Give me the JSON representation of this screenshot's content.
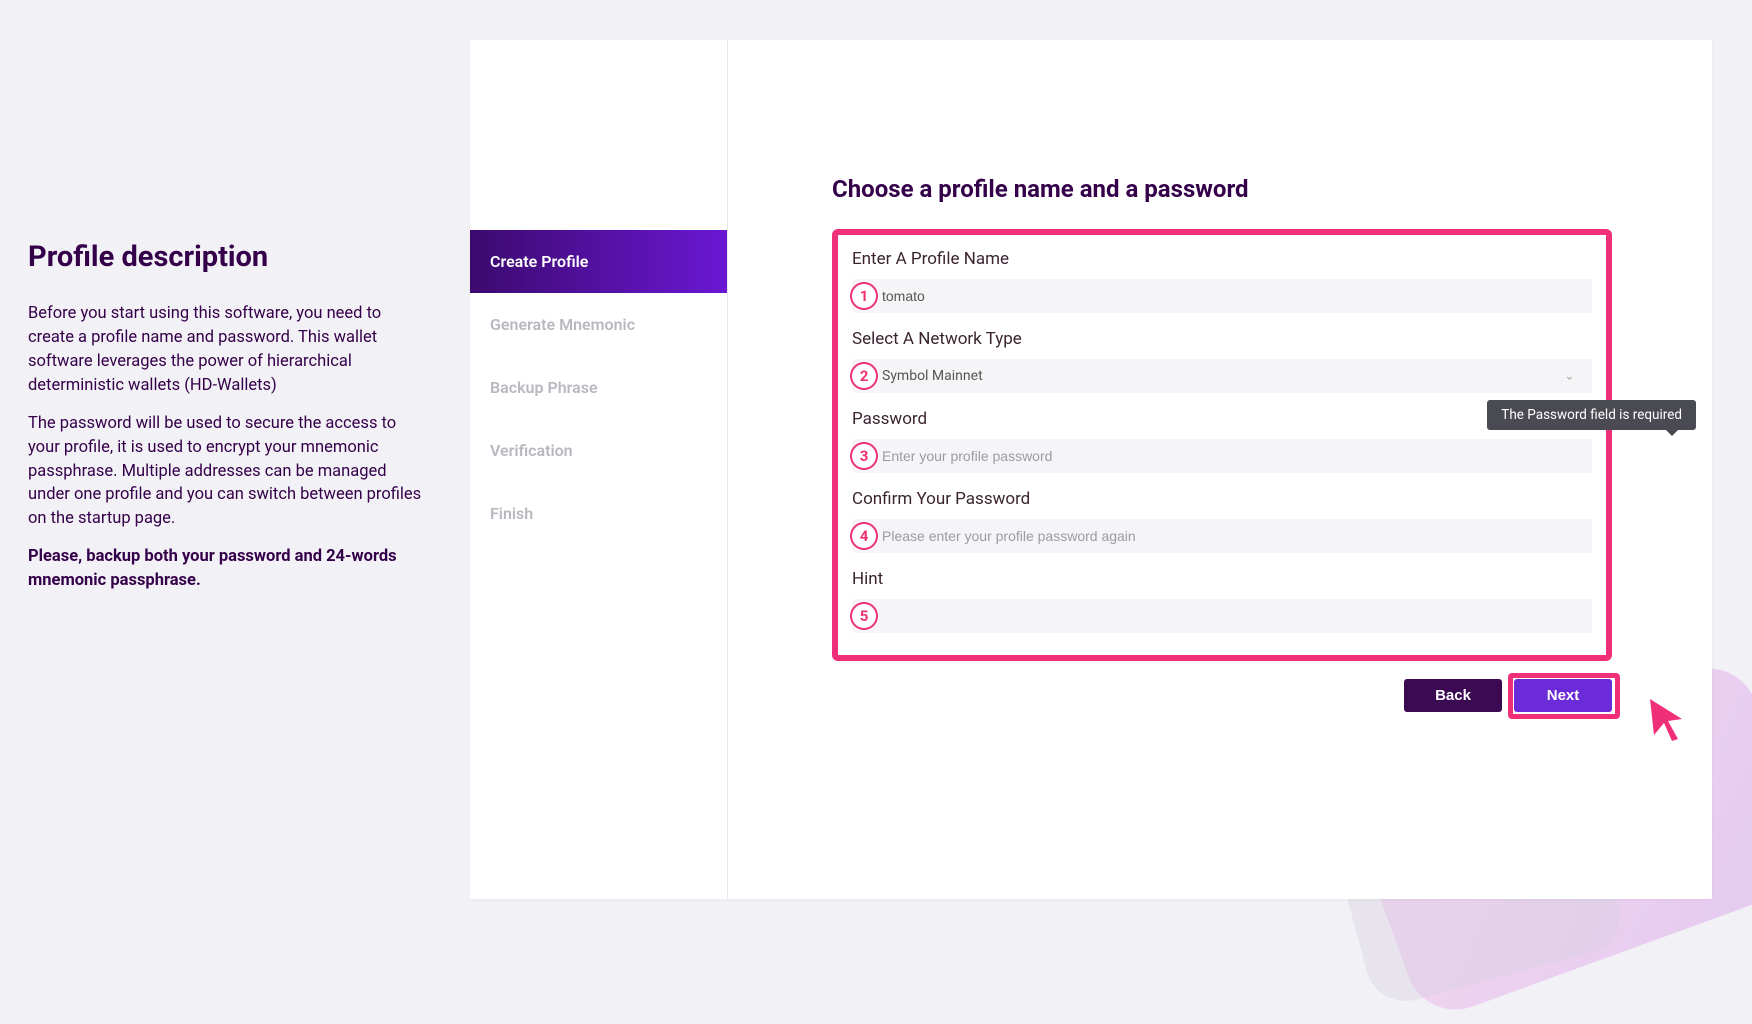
{
  "left": {
    "title": "Profile description",
    "p1": "Before you start using this software, you need to create a profile name and password. This wallet software leverages the power of hierarchical deterministic wallets (HD-Wallets)",
    "p2": "The password will be used to secure the access to your profile, it is used to encrypt your mnemonic passphrase. Multiple addresses can be managed under one profile and you can switch between profiles on the startup page.",
    "p3": "Please, backup both your password and 24-words mnemonic passphrase."
  },
  "sidebar": {
    "items": [
      {
        "label": "Create Profile",
        "active": true
      },
      {
        "label": "Generate Mnemonic",
        "active": false
      },
      {
        "label": "Backup Phrase",
        "active": false
      },
      {
        "label": "Verification",
        "active": false
      },
      {
        "label": "Finish",
        "active": false
      }
    ]
  },
  "form": {
    "title": "Choose a profile name and a password",
    "profile_name_label": "Enter A Profile Name",
    "profile_name_value": "tomato",
    "network_label": "Select A Network Type",
    "network_value": "Symbol Mainnet",
    "password_label": "Password",
    "password_placeholder": "Enter your profile password",
    "confirm_label": "Confirm Your Password",
    "confirm_placeholder": "Please enter your profile password again",
    "hint_label": "Hint",
    "hint_value": "",
    "tooltip": "The Password field is required",
    "back_label": "Back",
    "next_label": "Next"
  },
  "annotations": {
    "b1": "1",
    "b2": "2",
    "b3": "3",
    "b4": "4",
    "b5": "5"
  }
}
